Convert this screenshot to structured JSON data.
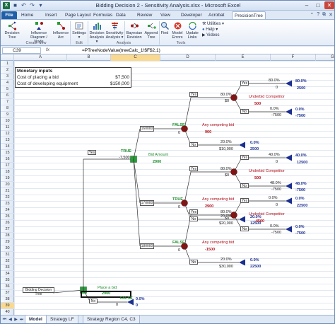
{
  "window": {
    "title": "Bidding Decision 2 - Sensitivity Analysis.xlsx - Microsoft Excel",
    "app_icon": "X",
    "qat_icons": [
      "save-icon",
      "undo-icon",
      "redo-icon",
      "customize-icon"
    ]
  },
  "tabs": [
    "File",
    "Home",
    "Insert",
    "Page Layout",
    "Formulas",
    "Data",
    "Review",
    "View",
    "Developer",
    "Acrobat",
    "PrecisionTree"
  ],
  "active_tab": "PrecisionTree",
  "ribbon": {
    "buttons": [
      {
        "label1": "Decision",
        "label2": "Tree",
        "icon": "decision-tree-icon"
      },
      {
        "label1": "Influence",
        "label2": "Diagram / Node",
        "icon": "influence-diagram-icon"
      },
      {
        "label1": "Influence",
        "label2": "Arc",
        "icon": "influence-arc-icon"
      },
      {
        "label1": "Settings",
        "label2": "▾",
        "icon": "settings-icon"
      },
      {
        "label1": "Decision",
        "label2": "Analysis ▾",
        "icon": "decision-analysis-icon"
      },
      {
        "label1": "Sensitivity",
        "label2": "Analysis ▾",
        "icon": "sensitivity-analysis-icon"
      },
      {
        "label1": "Bayesian",
        "label2": "Revision",
        "icon": "bayesian-revision-icon"
      },
      {
        "label1": "Append",
        "label2": "Tree",
        "icon": "append-tree-icon"
      },
      {
        "label1": "Find",
        "label2": "",
        "icon": "find-icon"
      },
      {
        "label1": "Model",
        "label2": "Errors",
        "icon": "model-errors-icon"
      },
      {
        "label1": "Update",
        "label2": "Links",
        "icon": "update-links-icon"
      }
    ],
    "groups": [
      "Create New",
      "Edit",
      "Analysis",
      "Tools"
    ],
    "side_menu": [
      "Utilities ▾",
      "Help ▾",
      "Videos"
    ]
  },
  "formula_bar": {
    "name_box": "C39",
    "fx": "fx",
    "formula": "=PTreeNodeValue(treeCalc_1!$F$2,1)"
  },
  "columns": [
    "A",
    "B",
    "C",
    "D",
    "E",
    "F",
    "G"
  ],
  "selected_column": "C",
  "rows": [
    "1",
    "2",
    "3",
    "4",
    "5",
    "6",
    "7",
    "8",
    "9",
    "10",
    "11",
    "12",
    "13",
    "14",
    "15",
    "16",
    "17",
    "18",
    "19",
    "20",
    "21",
    "22",
    "23",
    "24",
    "25",
    "26",
    "27",
    "28",
    "29",
    "30",
    "31",
    "32",
    "33",
    "34",
    "35",
    "36",
    "37",
    "38",
    "39",
    "40",
    "41"
  ],
  "selected_row": "39",
  "monetary": {
    "heading": "Monetary inputs",
    "rows": [
      {
        "label": "Cost of placing a bid",
        "value": "$7,500"
      },
      {
        "label": "Cost of developing equipment",
        "value": "$150,000"
      }
    ]
  },
  "tree": {
    "root_name": "Bidding Decision Tree",
    "place_bid": {
      "label": "Place a bid",
      "value": "2900"
    },
    "root_bool": "TRUE",
    "root_cost": "-7,500",
    "root_no": {
      "label": "No",
      "bool": "FALSE",
      "prob": "0.0%",
      "value": "0"
    },
    "bid_amount": {
      "label": "Bid Amount",
      "value": "2900"
    },
    "yes_label": "Yes",
    "no_label": "No",
    "bids": [
      {
        "amount": "160000",
        "bool": "FALSE",
        "zero": "0",
        "competing": {
          "label": "Any competing bid",
          "value": "900"
        },
        "yes_undercut": {
          "label": "Underbid Competitor",
          "value": "500",
          "yes": {
            "prob": "80.0%",
            "pay": "0",
            "final": "2500"
          },
          "no": {
            "prob": "0.0%",
            "pay": "-7500",
            "final": "-7500"
          }
        },
        "no_branch": {
          "prob": "0.0%",
          "pay": "$10,000",
          "final": "2500"
        },
        "probs": {
          "yes": "80.0%",
          "no": "20.0%"
        },
        "pays": {
          "yes": "$0",
          "no": "$10,000"
        }
      },
      {
        "amount": "170000",
        "bool": "TRUE",
        "zero": "0",
        "competing": {
          "label": "Any competing bid",
          "value": "2900"
        },
        "yes_undercut": {
          "label": "Underbid Competitor",
          "value": "500",
          "yes": {
            "prob": "40.0%",
            "pay": "0",
            "final": "12500"
          },
          "no": {
            "prob": "48.0%",
            "pay": "-7500",
            "final": "-7500"
          }
        },
        "no_branch": {
          "prob": "20.0%",
          "pay": "$20,000",
          "final": "12500"
        },
        "probs": {
          "yes": "80.0%",
          "no": "20.0%"
        },
        "pays": {
          "yes": "$0",
          "no": "$20,000"
        }
      },
      {
        "amount": "180000",
        "bool": "FALSE",
        "zero": "0",
        "competing": {
          "label": "Any competing bid",
          "value": "-1500"
        },
        "yes_undercut": {
          "label": "Underbid Competitor",
          "value": "-4500",
          "yes": {
            "prob": "0.0%",
            "pay": "0",
            "final": "22500"
          },
          "no": {
            "prob": "0.0%",
            "pay": "-7500",
            "final": "-7500"
          }
        },
        "no_branch": {
          "prob": "0.0%",
          "pay": "$30,000",
          "final": "22500"
        },
        "probs": {
          "yes": "80.0%",
          "no": "20.0%"
        },
        "pays": {
          "yes": "$0",
          "no": "$30,000"
        }
      }
    ]
  },
  "sheet_tabs": [
    "Model",
    "Strategy LF",
    "Strategy Region C4, C3"
  ],
  "active_sheet": "Model"
}
